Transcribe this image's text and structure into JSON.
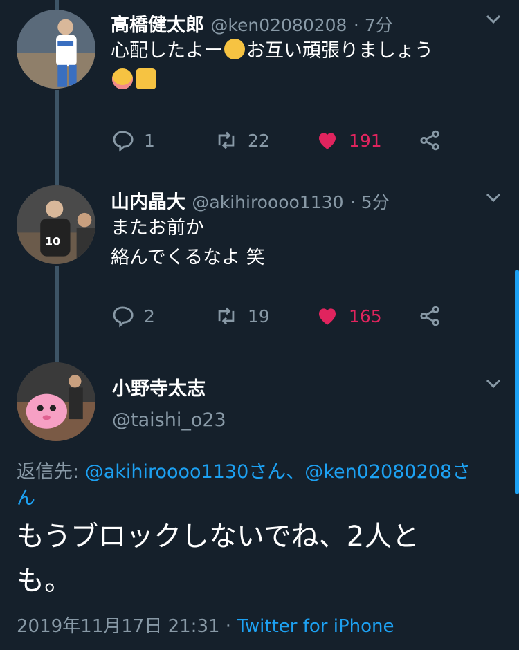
{
  "tweets": [
    {
      "name": "高橋健太郎",
      "handle": "@ken02080208",
      "time": "· 7分",
      "line1": "心配したよー",
      "line1b": "お互い頑張りましょう",
      "replies": "1",
      "retweets": "22",
      "likes": "191"
    },
    {
      "name": "山内晶大",
      "handle": "@akihiroooo1130",
      "time": "· 5分",
      "line1": "またお前か",
      "line2": "絡んでくるなよ 笑",
      "replies": "2",
      "retweets": "19",
      "likes": "165"
    }
  ],
  "main_tweet": {
    "name": "小野寺太志",
    "handle": "@taishi_o23",
    "reply_prefix": "返信先: ",
    "reply_to_1": "@akihiroooo1130さん、",
    "reply_to_2": "@ken02080208さ",
    "reply_to_3": "ん",
    "text_line1": "もうブロックしないでね、2人と",
    "text_line2": "も。",
    "timestamp": "2019年11月17日 21:31",
    "separator": " · ",
    "source": "Twitter for iPhone"
  },
  "icons": {
    "reply": "reply-icon",
    "retweet": "retweet-icon",
    "like": "heart-icon",
    "share": "share-icon",
    "more": "chevron-down-icon"
  },
  "colors": {
    "background": "#15202b",
    "accent": "#1da1f2",
    "like": "#e0245e",
    "muted": "#8899a6"
  }
}
